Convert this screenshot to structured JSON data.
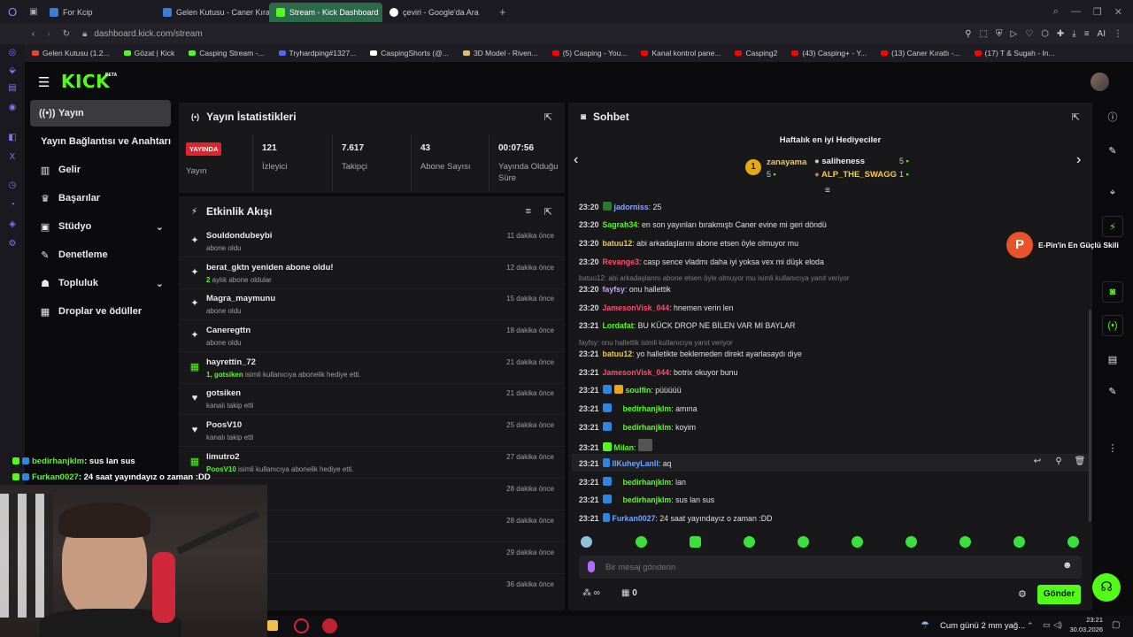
{
  "browser": {
    "tabs": [
      {
        "label": "For Kcip",
        "color": "#3b7dd8"
      },
      {
        "label": "Gelen Kutusu - Caner Kıratlı",
        "color": "#3b7dd8"
      },
      {
        "label": "Stream - Kick Dashboard",
        "color": "#53fc18"
      },
      {
        "label": "çeviri - Google'da Ara",
        "color": "#ffffff"
      }
    ],
    "url": "dashboard.kick.com/stream",
    "bookmarks": [
      {
        "label": "Gelen Kutusu (1.2...",
        "color": "#ea4335"
      },
      {
        "label": "Gözat | Kick",
        "color": "#53fc18"
      },
      {
        "label": "Casping Stream -...",
        "color": "#53fc18"
      },
      {
        "label": "Tryhardping#1327...",
        "color": "#5865f2"
      },
      {
        "label": "CaspingShorts (@...",
        "color": "#ffffff"
      },
      {
        "label": "3D Model - Riven...",
        "color": "#e0c060"
      },
      {
        "label": "(5) Casping - You...",
        "color": "#ff0000"
      },
      {
        "label": "Kanal kontrol pane...",
        "color": "#ff0000"
      },
      {
        "label": "Casping2",
        "color": "#ff0000"
      },
      {
        "label": "(43) Casping+ - Y...",
        "color": "#ff0000"
      },
      {
        "label": "(13) Caner Kıratlı -...",
        "color": "#ff0000"
      },
      {
        "label": "(17) T & Sugah - In...",
        "color": "#ff0000"
      }
    ]
  },
  "kick": {
    "logo": "KICK",
    "logo_beta": "BETA",
    "accent": "#53fc18"
  },
  "sidebar": {
    "items": [
      {
        "label": "Yayın",
        "icon": "broadcast-icon"
      },
      {
        "label": "Yayın Bağlantısı ve Anahtarı",
        "icon": "none"
      },
      {
        "label": "Gelir",
        "icon": "chart-icon"
      },
      {
        "label": "Başarılar",
        "icon": "trophy-icon"
      },
      {
        "label": "Stüdyo",
        "icon": "studio-icon"
      },
      {
        "label": "Denetleme",
        "icon": "wrench-icon"
      },
      {
        "label": "Topluluk",
        "icon": "people-icon"
      },
      {
        "label": "Droplar ve ödüller",
        "icon": "gift-icon"
      }
    ]
  },
  "stats": {
    "title": "Yayın İstatistikleri",
    "live_badge": "YAYINDA",
    "live_label": "Yayın",
    "items": [
      {
        "value": "121",
        "label": "İzleyici"
      },
      {
        "value": "7.617",
        "label": "Takipçi"
      },
      {
        "value": "43",
        "label": "Abone Sayısı"
      },
      {
        "value": "00:07:56",
        "label": "Yayında Olduğu Süre"
      }
    ]
  },
  "activity": {
    "title": "Etkinlik Akışı",
    "events": [
      {
        "name": "Souldondubeybi",
        "sub": "abone oldu",
        "time": "11 dakika önce",
        "icon": "sparkle-icon"
      },
      {
        "name": "berat_gktn yeniden abone oldu!",
        "sub_hl": "2",
        "sub": " aylık abone oldular",
        "time": "12 dakika önce",
        "icon": "sparkle-icon"
      },
      {
        "name": "Magra_maymunu",
        "sub": "abone oldu",
        "time": "15 dakika önce",
        "icon": "sparkle-icon"
      },
      {
        "name": "Caneregttn",
        "sub": "abone oldu",
        "time": "18 dakika önce",
        "icon": "sparkle-icon"
      },
      {
        "name": "hayrettin_72",
        "sub_hl": "1, gotsiken",
        "sub": " isimli kullanıcıya abonelik hediye etti.",
        "time": "21 dakika önce",
        "icon": "gift-icon"
      },
      {
        "name": "gotsiken",
        "sub": "kanalı takip etti",
        "time": "21 dakika önce",
        "icon": "heart-icon"
      },
      {
        "name": "PoosV10",
        "sub": "kanalı takip etti",
        "time": "25 dakika önce",
        "icon": "heart-icon"
      },
      {
        "name": "limutro2",
        "sub_hl": "PoosV10",
        "sub": " isimli kullanıcıya abonelik hediye etti.",
        "time": "27 dakika önce",
        "icon": "gift-icon"
      },
      {
        "name": "",
        "sub": "",
        "time": "28 dakika önce",
        "icon": "none"
      },
      {
        "name": "",
        "sub": "",
        "time": "28 dakika önce",
        "icon": "none"
      },
      {
        "name": "",
        "sub": "",
        "time": "29 dakika önce",
        "icon": "none"
      },
      {
        "name": "",
        "sub": "",
        "time": "36 dakika önce",
        "icon": "none"
      }
    ]
  },
  "chat": {
    "title": "Sohbet",
    "gifters_title": "Haftalık en iyi Hediyeciler",
    "gifters": [
      {
        "rank": "1",
        "name": "zanayama",
        "count": "5"
      },
      {
        "name": "saliheness",
        "count": "5"
      },
      {
        "name": "ALP_THE_SWAGG",
        "count": "1"
      }
    ],
    "messages": [
      {
        "time": "23:20",
        "user": "jadorniss",
        "color": "#8fa6ff",
        "text": ": 25"
      },
      {
        "time": "23:20",
        "user": "Sagrah34",
        "color": "#53fc18",
        "text": ": en son yayınları bırakmıştı Caner evine mi geri döndü"
      },
      {
        "time": "23:20",
        "user": "batuu12",
        "color": "#f2c94c",
        "text": ": abi arkadaşlarını abone etsen öyle olmuyor mu"
      },
      {
        "time": "23:20",
        "user": "Revange3",
        "color": "#ff4d6d",
        "text": ": casp sence vladmı daha iyi yoksa vex mi düşk eloda"
      },
      {
        "reply": "batuu12: abi arkadaşlarını abone etsen öyle olmuyor mu isimli kullanıcıya yanıt veriyor"
      },
      {
        "time": "23:20",
        "user": "fayfsy",
        "color": "#c9a0ff",
        "text": ": onu hallettik"
      },
      {
        "time": "23:20",
        "user": "JamesonVisk_044",
        "color": "#ff4d6d",
        "text": ": hnemen verin len"
      },
      {
        "time": "23:21",
        "user": "Lordafat",
        "color": "#53fc18",
        "text": ": BU KÜCK DROP NE BİLEN VAR MI BAYLAR"
      },
      {
        "reply": "fayfsy: onu hallettik isimli kullanıcıya yanıt veriyor"
      },
      {
        "time": "23:21",
        "user": "batuu12",
        "color": "#f2c94c",
        "text": ": yo halletikte beklemeden direkt ayarlasaydı diye"
      },
      {
        "time": "23:21",
        "user": "JamesonVisk_044",
        "color": "#ff4d6d",
        "text": ": botrix okuyor bunu"
      },
      {
        "time": "23:21",
        "user": "soulfin",
        "color": "#53fc18",
        "text": ": püüüüü"
      },
      {
        "time": "23:21",
        "user": "bedirhanjklm",
        "color": "#53fc18",
        "text": ": amına"
      },
      {
        "time": "23:21",
        "user": "bedirhanjklm",
        "color": "#53fc18",
        "text": ": koyim"
      },
      {
        "time": "23:21",
        "user": "Milan",
        "color": "#53fc18",
        "text": ":"
      },
      {
        "time": "23:21",
        "user": "llKuheyLanll",
        "color": "#6ea8ff",
        "text": ": aq"
      },
      {
        "time": "23:21",
        "user": "bedirhanjklm",
        "color": "#53fc18",
        "text": ": lan"
      },
      {
        "time": "23:21",
        "user": "bedirhanjklm",
        "color": "#53fc18",
        "text": ": sus lan sus"
      },
      {
        "time": "23:21",
        "user": "Furkan0027",
        "color": "#6ea8ff",
        "text": ": 24 saat yayındayız o zaman :DD"
      }
    ],
    "input_placeholder": "Bir mesaj gönderin",
    "send_label": "Gönder",
    "points": "∞",
    "gift_count": "0"
  },
  "overlay": {
    "line1_user": "bedirhanjklm",
    "line1_text": ": sus lan sus",
    "line2_user": "Furkan0027",
    "line2_text": ": 24 saat yayındayız o zaman :DD",
    "promo": "E-Pin'in En Güçlü Skili"
  },
  "taskbar": {
    "weather": "Cum günü 2 mm yağ...",
    "time": "23:21",
    "date": "30.03.2026"
  }
}
